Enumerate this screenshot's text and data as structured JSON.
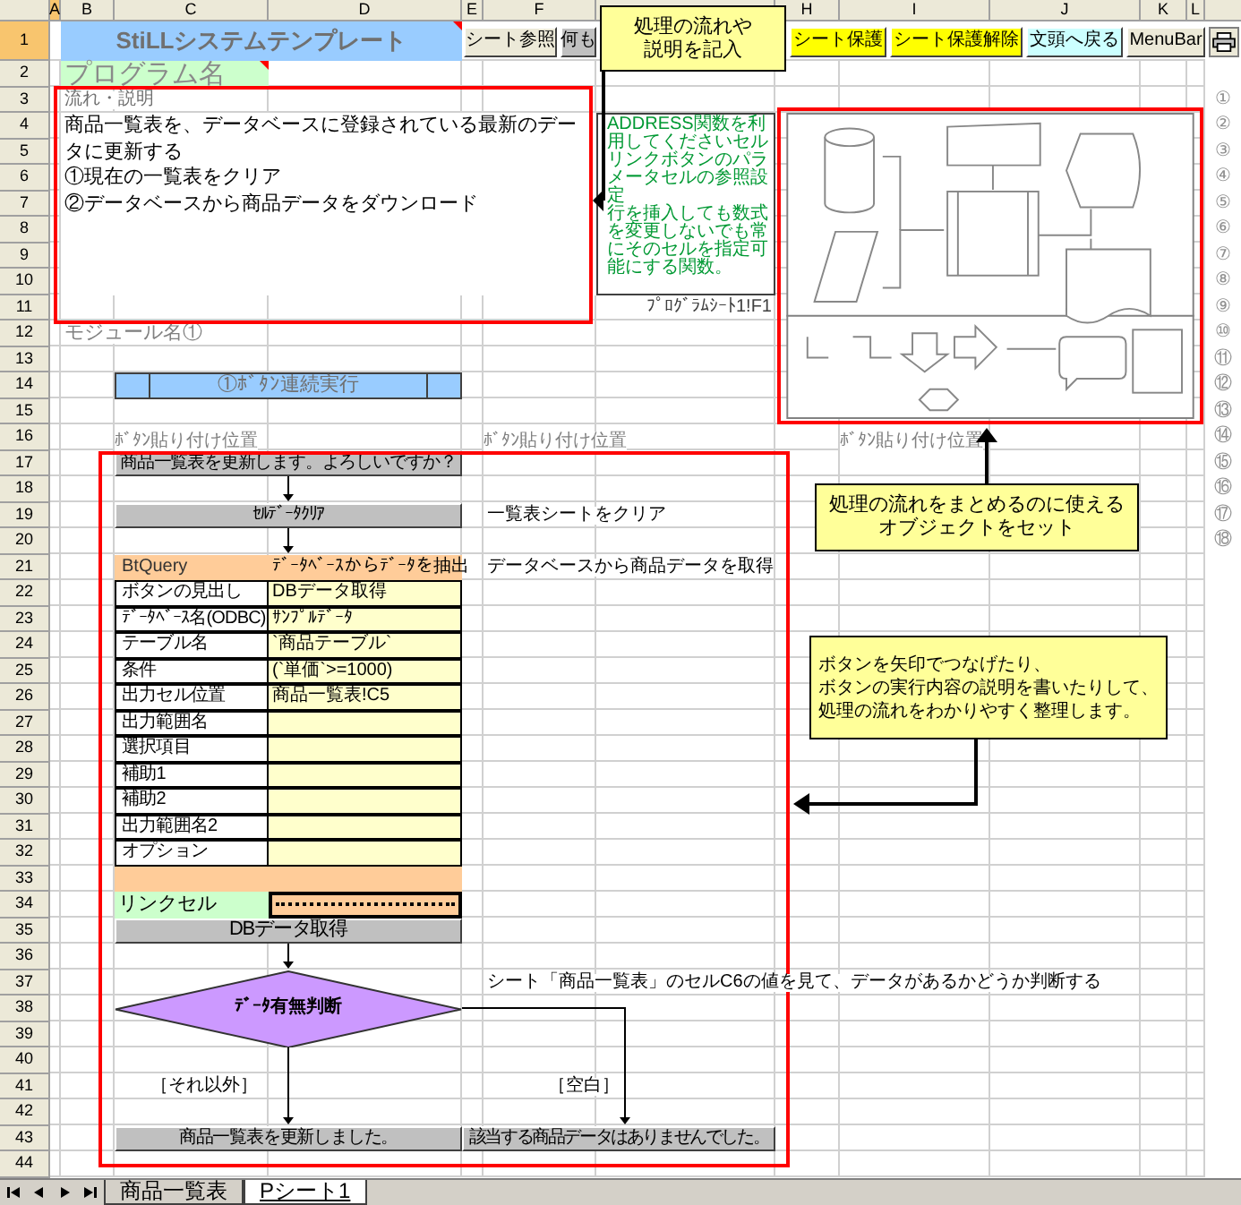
{
  "column_headers": [
    {
      "label": "A",
      "selected": true
    },
    {
      "label": "B",
      "selected": false
    },
    {
      "label": "C",
      "selected": false
    },
    {
      "label": "D",
      "selected": false
    },
    {
      "label": "E",
      "selected": false
    },
    {
      "label": "F",
      "selected": false
    },
    {
      "selected": false
    },
    {
      "label": "H",
      "selected": false
    },
    {
      "label": "I",
      "selected": false
    },
    {
      "label": "J",
      "selected": false
    },
    {
      "label": "K",
      "selected": false
    },
    {
      "label": "L",
      "selected": false
    }
  ],
  "row_headers": [
    {
      "label": "1",
      "selected": true
    },
    {
      "label": "2",
      "selected": false
    },
    {
      "label": "3",
      "selected": false
    },
    {
      "label": "4",
      "selected": false
    },
    {
      "label": "5",
      "selected": false
    },
    {
      "label": "6",
      "selected": false
    },
    {
      "label": "7",
      "selected": false
    },
    {
      "label": "8",
      "selected": false
    },
    {
      "label": "9",
      "selected": false
    },
    {
      "label": "10",
      "selected": false
    },
    {
      "label": "11",
      "selected": false
    },
    {
      "label": "12",
      "selected": false
    },
    {
      "label": "13",
      "selected": false
    },
    {
      "label": "14",
      "selected": false
    },
    {
      "label": "15",
      "selected": false
    },
    {
      "label": "16",
      "selected": false
    },
    {
      "label": "17",
      "selected": false
    },
    {
      "label": "18",
      "selected": false
    },
    {
      "label": "19",
      "selected": false
    },
    {
      "label": "20",
      "selected": false
    },
    {
      "label": "21",
      "selected": false
    },
    {
      "label": "22",
      "selected": false
    },
    {
      "label": "23",
      "selected": false
    },
    {
      "label": "24",
      "selected": false
    },
    {
      "label": "25",
      "selected": false
    },
    {
      "label": "26",
      "selected": false
    },
    {
      "label": "27",
      "selected": false
    },
    {
      "label": "28",
      "selected": false
    },
    {
      "label": "29",
      "selected": false
    },
    {
      "label": "30",
      "selected": false
    },
    {
      "label": "31",
      "selected": false
    },
    {
      "label": "32",
      "selected": false
    },
    {
      "label": "33",
      "selected": false
    },
    {
      "label": "34",
      "selected": false
    },
    {
      "label": "35",
      "selected": false
    },
    {
      "label": "36",
      "selected": false
    },
    {
      "label": "37",
      "selected": false
    },
    {
      "label": "38",
      "selected": false
    },
    {
      "label": "39",
      "selected": false
    },
    {
      "label": "40",
      "selected": false
    },
    {
      "label": "41",
      "selected": false
    },
    {
      "label": "42",
      "selected": false
    },
    {
      "label": "43",
      "selected": false
    },
    {
      "label": "44",
      "selected": false
    }
  ],
  "title_cell": "StiLLシステムテンプレート",
  "toolbar_buttons": [
    {
      "label": "シート参照",
      "color": "#ece9d8"
    },
    {
      "label": "何も",
      "color": "#c0c0c0"
    },
    {
      "label": "シート保護",
      "color": "#ffff00"
    },
    {
      "label": "シート保護解除",
      "color": "#ffff00"
    },
    {
      "label": "文頭へ戻る",
      "color": "#ccffff"
    },
    {
      "label": "MenuBar",
      "color": "#ece9d8"
    }
  ],
  "program_name": "プログラム名",
  "description": {
    "label": "流れ・説明",
    "lines": [
      "商品一覧表を、データベースに登録されている最新のデータに更新する",
      "①現在の一覧表をクリア",
      "②データベースから商品データをダウンロード"
    ]
  },
  "note": {
    "paragraphs": [
      "ADDRESS関数を利用してくださいセルリンクボタンのパラメータセルの参照設定",
      "行を挿入しても数式を変更しないでも常にそのセルを指定可能にする関数。"
    ],
    "reference": "ﾌﾟﾛｸﾞﾗﾑｼｰﾄ1!F1"
  },
  "module_name": "モジュール名①",
  "chain_button": "①ﾎﾞﾀﾝ連続実行",
  "placement_labels": [
    "ﾎﾞﾀﾝ貼り付け位置",
    "ﾎﾞﾀﾝ貼り付け位置",
    "ﾎﾞﾀﾝ貼り付け位置"
  ],
  "flow": {
    "confirm_button": "商品一覧表を更新します。よろしいですか？",
    "clear_button": "ｾﾙﾃﾞｰﾀｸﾘｱ",
    "query_name": "BtQuery",
    "query_title": "ﾃﾞｰﾀﾍﾞｰｽからﾃﾞｰﾀを抽出",
    "params": [
      {
        "label": "ボタンの見出し",
        "value": "DBデータ取得"
      },
      {
        "label": "ﾃﾞｰﾀﾍﾞｰｽ名(ODBC)",
        "value": "ｻﾝﾌﾟﾙﾃﾞｰﾀ"
      },
      {
        "label": "テーブル名",
        "value": "`商品テーブル`"
      },
      {
        "label": "条件",
        "value": "(`単価`>=1000)"
      },
      {
        "label": "出力セル位置",
        "value": "商品一覧表!C5"
      },
      {
        "label": "出力範囲名"
      },
      {
        "label": "選択項目"
      },
      {
        "label": "補助1"
      },
      {
        "label": "補助2"
      },
      {
        "label": "出力範囲名2"
      },
      {
        "label": "オプション"
      }
    ],
    "link_cell_label": "リンクセル",
    "fetch_button": "DBデータ取得",
    "decision": "ﾃﾞｰﾀ有無判断",
    "branch_labels": [
      "［それ以外］",
      "［空白］"
    ],
    "end_buttons": [
      "商品一覧表を更新しました。",
      "該当する商品データはありませんでした。"
    ]
  },
  "comments": [
    "一覧表シートをクリア",
    "データベースから商品データを取得",
    "シート「商品一覧表」のセルC6の値を見て、データがあるかどうか判断する"
  ],
  "callouts": [
    {
      "lines": [
        "処理の流れや",
        "説明を記入"
      ]
    },
    {
      "lines": [
        "処理の流れをまとめるのに使える",
        "オブジェクトをセット"
      ]
    },
    {
      "lines": [
        "ボタンを矢印でつなげたり、",
        "ボタンの実行内容の説明を書いたりして、",
        "処理の流れをわかりやすく整理します。"
      ]
    }
  ],
  "margin_numbers": [
    "①",
    "②",
    "③",
    "④",
    "⑤",
    "⑥",
    "⑦",
    "⑧",
    "⑨",
    "⑩",
    "⑪",
    "⑫",
    "⑬",
    "⑭",
    "⑮",
    "⑯",
    "⑰",
    "⑱"
  ],
  "sheet_tabs": [
    {
      "label": "商品一覧表",
      "selected": false
    },
    {
      "label": "Pシート1",
      "selected": true
    }
  ]
}
